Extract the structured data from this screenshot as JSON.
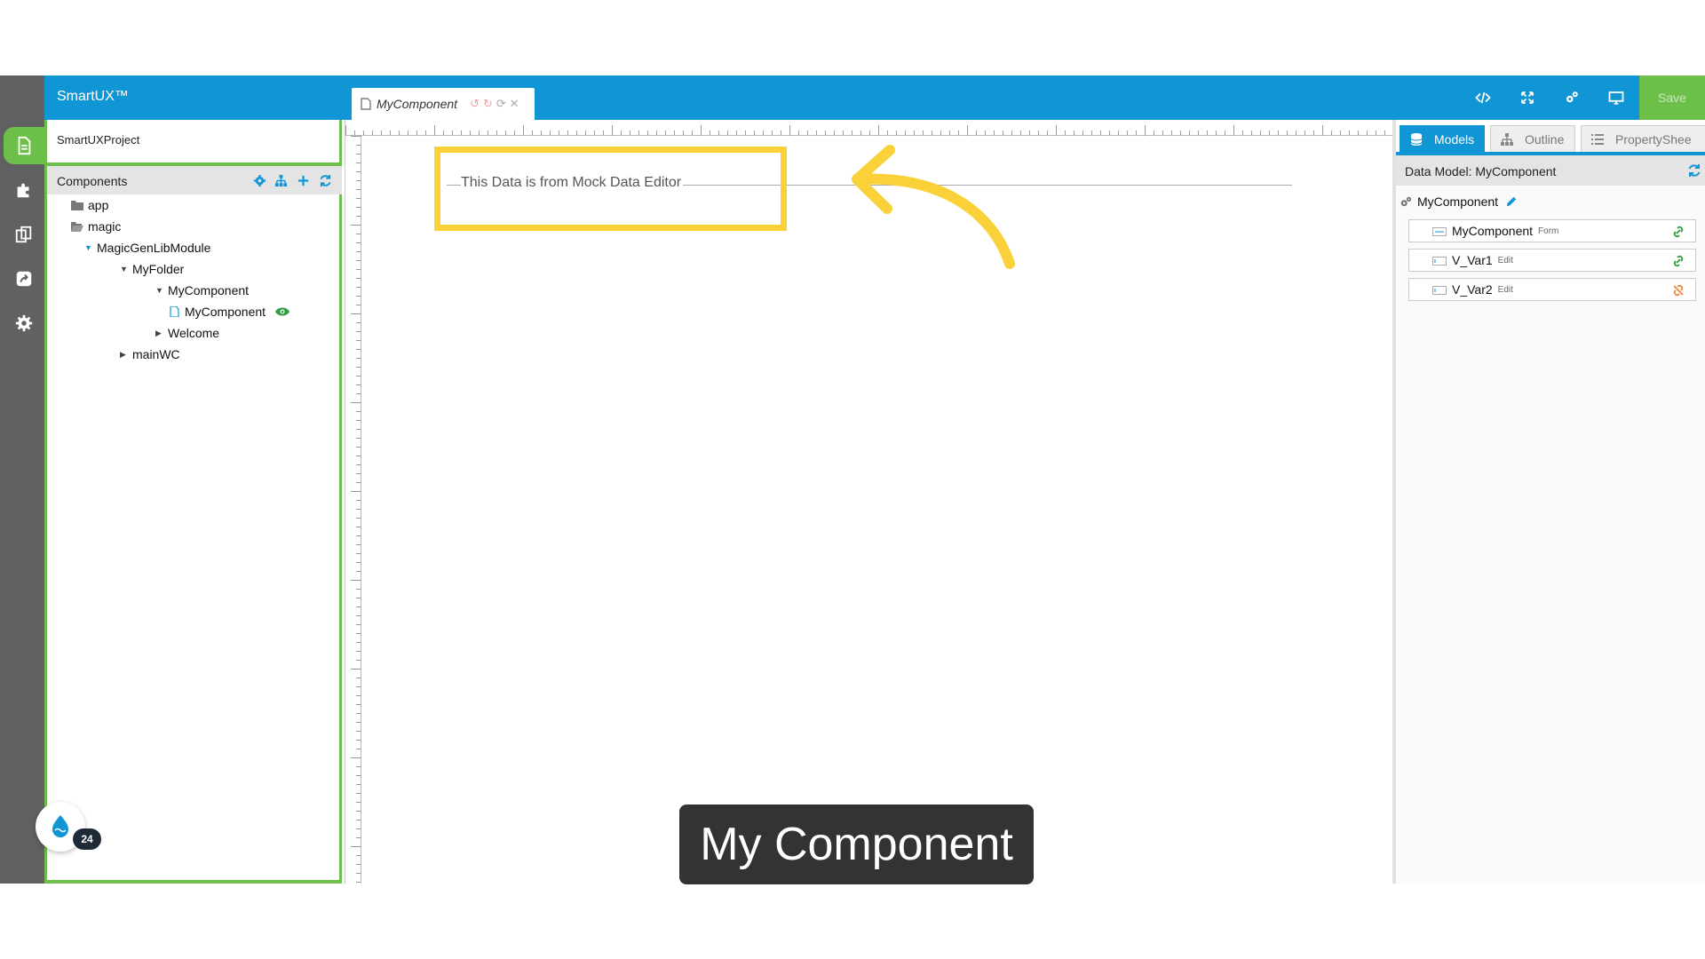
{
  "app": {
    "brand": "SmartUX™"
  },
  "editor_tab": {
    "title": "MyComponent"
  },
  "toolbar": {
    "save_label": "Save"
  },
  "project": {
    "name": "SmartUXProject"
  },
  "components_panel": {
    "title": "Components"
  },
  "tree": [
    {
      "label": "app",
      "icon": "folder-icon"
    },
    {
      "label": "magic",
      "icon": "folder-open-icon"
    },
    {
      "label": "MagicGenLibModule",
      "caret": "expanded"
    },
    {
      "label": "MyFolder",
      "caret": "expanded"
    },
    {
      "label": "MyComponent",
      "caret": "expanded"
    },
    {
      "label": "MyComponent",
      "icon": "file-icon",
      "badge": "eye-icon"
    },
    {
      "label": "Welcome",
      "caret": "collapsed"
    },
    {
      "label": "mainWC",
      "caret": "collapsed"
    }
  ],
  "canvas": {
    "text": "This Data is from Mock Data Editor"
  },
  "right_panel": {
    "tabs": [
      {
        "label": "Models",
        "icon": "database-icon",
        "active": true
      },
      {
        "label": "Outline",
        "icon": "sitemap-icon",
        "active": false
      },
      {
        "label": "PropertyShee",
        "icon": "list-icon",
        "active": false
      }
    ],
    "data_model_title": "Data Model: MyComponent",
    "root": "MyComponent",
    "rows": [
      {
        "name": "MyComponent",
        "type": "Form",
        "status": "linked"
      },
      {
        "name": "V_Var1",
        "type": "Edit",
        "status": "linked"
      },
      {
        "name": "V_Var2",
        "type": "Edit",
        "status": "unlinked"
      }
    ]
  },
  "logo": {
    "count": "24"
  },
  "caption": "My Component",
  "colors": {
    "topbar": "#1196d5",
    "accent_green": "#6cc04a",
    "highlight": "#fbd13a",
    "rail": "#616161"
  }
}
